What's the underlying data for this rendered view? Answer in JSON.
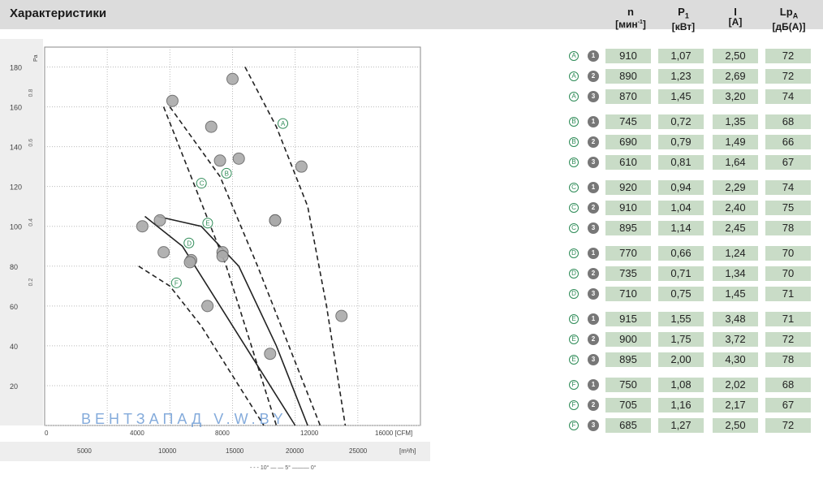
{
  "header": {
    "title": "Характеристики",
    "columns": [
      {
        "symbol": "n",
        "sub": "",
        "unit_pre": "[мин",
        "unit_sup": "-1",
        "unit_post": "]"
      },
      {
        "symbol": "P",
        "sub": "1",
        "unit_pre": "[кВт]",
        "unit_sup": "",
        "unit_post": ""
      },
      {
        "symbol": "I",
        "sub": "",
        "unit_pre": "[A]",
        "unit_sup": "",
        "unit_post": ""
      },
      {
        "symbol": "Lp",
        "sub": "A",
        "unit_pre": "[дБ(А)]",
        "unit_sup": "",
        "unit_post": ""
      }
    ]
  },
  "table": {
    "rows": [
      {
        "curve": "A",
        "speed": "1",
        "n": "910",
        "p1": "1,07",
        "i": "2,50",
        "lpa": "72"
      },
      {
        "curve": "A",
        "speed": "2",
        "n": "890",
        "p1": "1,23",
        "i": "2,69",
        "lpa": "72"
      },
      {
        "curve": "A",
        "speed": "3",
        "n": "870",
        "p1": "1,45",
        "i": "3,20",
        "lpa": "74"
      },
      {
        "curve": "B",
        "speed": "1",
        "n": "745",
        "p1": "0,72",
        "i": "1,35",
        "lpa": "68"
      },
      {
        "curve": "B",
        "speed": "2",
        "n": "690",
        "p1": "0,79",
        "i": "1,49",
        "lpa": "66"
      },
      {
        "curve": "B",
        "speed": "3",
        "n": "610",
        "p1": "0,81",
        "i": "1,64",
        "lpa": "67"
      },
      {
        "curve": "C",
        "speed": "1",
        "n": "920",
        "p1": "0,94",
        "i": "2,29",
        "lpa": "74"
      },
      {
        "curve": "C",
        "speed": "2",
        "n": "910",
        "p1": "1,04",
        "i": "2,40",
        "lpa": "75"
      },
      {
        "curve": "C",
        "speed": "3",
        "n": "895",
        "p1": "1,14",
        "i": "2,45",
        "lpa": "78"
      },
      {
        "curve": "D",
        "speed": "1",
        "n": "770",
        "p1": "0,66",
        "i": "1,24",
        "lpa": "70"
      },
      {
        "curve": "D",
        "speed": "2",
        "n": "735",
        "p1": "0,71",
        "i": "1,34",
        "lpa": "70"
      },
      {
        "curve": "D",
        "speed": "3",
        "n": "710",
        "p1": "0,75",
        "i": "1,45",
        "lpa": "71"
      },
      {
        "curve": "E",
        "speed": "1",
        "n": "915",
        "p1": "1,55",
        "i": "3,48",
        "lpa": "71"
      },
      {
        "curve": "E",
        "speed": "2",
        "n": "900",
        "p1": "1,75",
        "i": "3,72",
        "lpa": "72"
      },
      {
        "curve": "E",
        "speed": "3",
        "n": "895",
        "p1": "2,00",
        "i": "4,30",
        "lpa": "78"
      },
      {
        "curve": "F",
        "speed": "1",
        "n": "750",
        "p1": "1,08",
        "i": "2,02",
        "lpa": "68"
      },
      {
        "curve": "F",
        "speed": "2",
        "n": "705",
        "p1": "1,16",
        "i": "2,17",
        "lpa": "67"
      },
      {
        "curve": "F",
        "speed": "3",
        "n": "685",
        "p1": "1,27",
        "i": "2,50",
        "lpa": "72"
      }
    ]
  },
  "watermark": {
    "text": "ВЕНТЗАПАД V.W.BY"
  },
  "chart_data": {
    "type": "line",
    "title": "",
    "xlabel": "[m³/h]",
    "ylabel": "Pa",
    "x_ticks_cfm": [
      "0",
      "4000",
      "8000",
      "12000",
      "16000 [CFM]"
    ],
    "x_ticks_m3h": [
      "5000",
      "10000",
      "15000",
      "20000",
      "25000",
      "[m³/h]"
    ],
    "y_ticks": [
      0,
      20,
      40,
      60,
      80,
      100,
      120,
      140,
      160,
      180
    ],
    "y_tick_labels": [
      "",
      "20",
      "40",
      "60",
      "80",
      "100",
      "120",
      "140",
      "160",
      "180"
    ],
    "y_secondary_labels": [
      "0.2",
      "0.4",
      "0.6",
      "0.8"
    ],
    "xlim": [
      0,
      30000
    ],
    "ylim": [
      0,
      190
    ],
    "grid": true,
    "legend_footer": "- - - 10° — — 5° ——— 0°",
    "series": [
      {
        "name": "A",
        "style": "dashed",
        "x": [
          16000,
          18500,
          21000,
          22500,
          24000
        ],
        "y": [
          180,
          150,
          110,
          60,
          0
        ]
      },
      {
        "name": "B",
        "style": "dashed",
        "x": [
          10000,
          14000,
          17000,
          19500,
          22000
        ],
        "y": [
          160,
          125,
          80,
          40,
          0
        ]
      },
      {
        "name": "C",
        "style": "dashed",
        "x": [
          9500,
          12000,
          14500,
          16500,
          18500
        ],
        "y": [
          160,
          120,
          80,
          40,
          0
        ]
      },
      {
        "name": "D",
        "style": "solid",
        "x": [
          8000,
          11000,
          14000,
          17000,
          20000
        ],
        "y": [
          105,
          90,
          60,
          30,
          0
        ]
      },
      {
        "name": "E",
        "style": "solid",
        "x": [
          9000,
          12500,
          15500,
          18500,
          21000
        ],
        "y": [
          105,
          100,
          80,
          40,
          0
        ]
      },
      {
        "name": "F",
        "style": "dashed",
        "x": [
          7500,
          10000,
          12500,
          15000,
          17500
        ],
        "y": [
          80,
          70,
          50,
          25,
          0
        ]
      }
    ],
    "operating_points": [
      {
        "curve": "A",
        "x": [
          15000,
          20500,
          23700
        ],
        "y": [
          174,
          130,
          55
        ]
      },
      {
        "curve": "B",
        "x": [
          13300,
          15500,
          18400
        ],
        "y": [
          150,
          134,
          103
        ]
      },
      {
        "curve": "C",
        "x": [
          10200,
          14000,
          18400
        ],
        "y": [
          163,
          133,
          103
        ]
      },
      {
        "curve": "D",
        "x": [
          7800,
          11700,
          14200
        ],
        "y": [
          100,
          83,
          87
        ]
      },
      {
        "curve": "E",
        "x": [
          9200,
          11600,
          14200
        ],
        "y": [
          103,
          82,
          85
        ]
      },
      {
        "curve": "F",
        "x": [
          9500,
          13000,
          18000
        ],
        "y": [
          87,
          60,
          36
        ]
      }
    ]
  }
}
